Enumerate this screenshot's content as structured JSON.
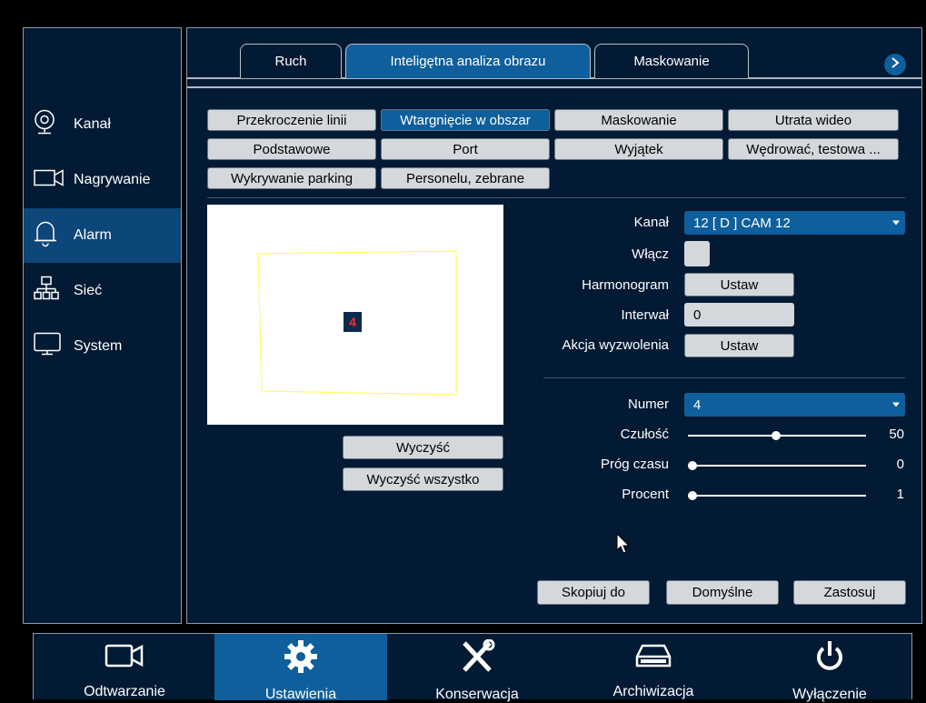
{
  "sidebar": {
    "items": [
      {
        "label": "Kanał",
        "icon": "camera-lens-icon"
      },
      {
        "label": "Nagrywanie",
        "icon": "video-camera-icon"
      },
      {
        "label": "Alarm",
        "icon": "bell-icon"
      },
      {
        "label": "Sieć",
        "icon": "network-icon"
      },
      {
        "label": "System",
        "icon": "monitor-icon"
      }
    ],
    "active": "Alarm"
  },
  "tabs": [
    "Ruch",
    "Inteligętna analiza obrazu",
    "Maskowanie"
  ],
  "active_tab": "Inteligętna analiza obrazu",
  "subtabs": {
    "row1": [
      "Przekroczenie linii",
      "Wtargnięcie w obszar",
      "Maskowanie",
      "Utrata wideo"
    ],
    "row2": [
      "Podstawowe",
      "Port",
      "Wyjątek",
      "Wędrować, testowa ..."
    ],
    "row3": [
      "Wykrywanie parking",
      "Personelu, zebrane"
    ],
    "active": "Wtargnięcie w obszar"
  },
  "preview": {
    "zone_number": "4"
  },
  "buttons": {
    "clear": "Wyczyść",
    "clear_all": "Wyczyść wszystko",
    "copy_to": "Skopiuj do",
    "defaults": "Domyślne",
    "apply": "Zastosuj"
  },
  "form": {
    "kanal_label": "Kanał",
    "kanal_value": "12 [ D ] CAM 12",
    "wlacz_label": "Włącz",
    "harmonogram_label": "Harmonogram",
    "harmonogram_btn": "Ustaw",
    "interwal_label": "Interwał",
    "interwal_value": "0",
    "akcja_label": "Akcja wyzwolenia",
    "akcja_btn": "Ustaw",
    "numer_label": "Numer",
    "numer_value": "4",
    "czulosc_label": "Czułość",
    "czulosc_value": "50",
    "prog_label": "Próg czasu",
    "prog_value": "0",
    "procent_label": "Procent",
    "procent_value": "1"
  },
  "bottom_nav": [
    {
      "label": "Odtwarzanie",
      "icon": "video-camera-icon"
    },
    {
      "label": "Ustawienia",
      "icon": "gear-icon"
    },
    {
      "label": "Konserwacja",
      "icon": "tools-icon"
    },
    {
      "label": "Archiwizacja",
      "icon": "drive-icon"
    },
    {
      "label": "Wyłączenie",
      "icon": "power-icon"
    }
  ],
  "bottom_active": "Ustawienia",
  "colors": {
    "background": "#021a33",
    "active": "#0e5f9b",
    "button": "#d4d8dc",
    "zone": "#ffff66"
  }
}
